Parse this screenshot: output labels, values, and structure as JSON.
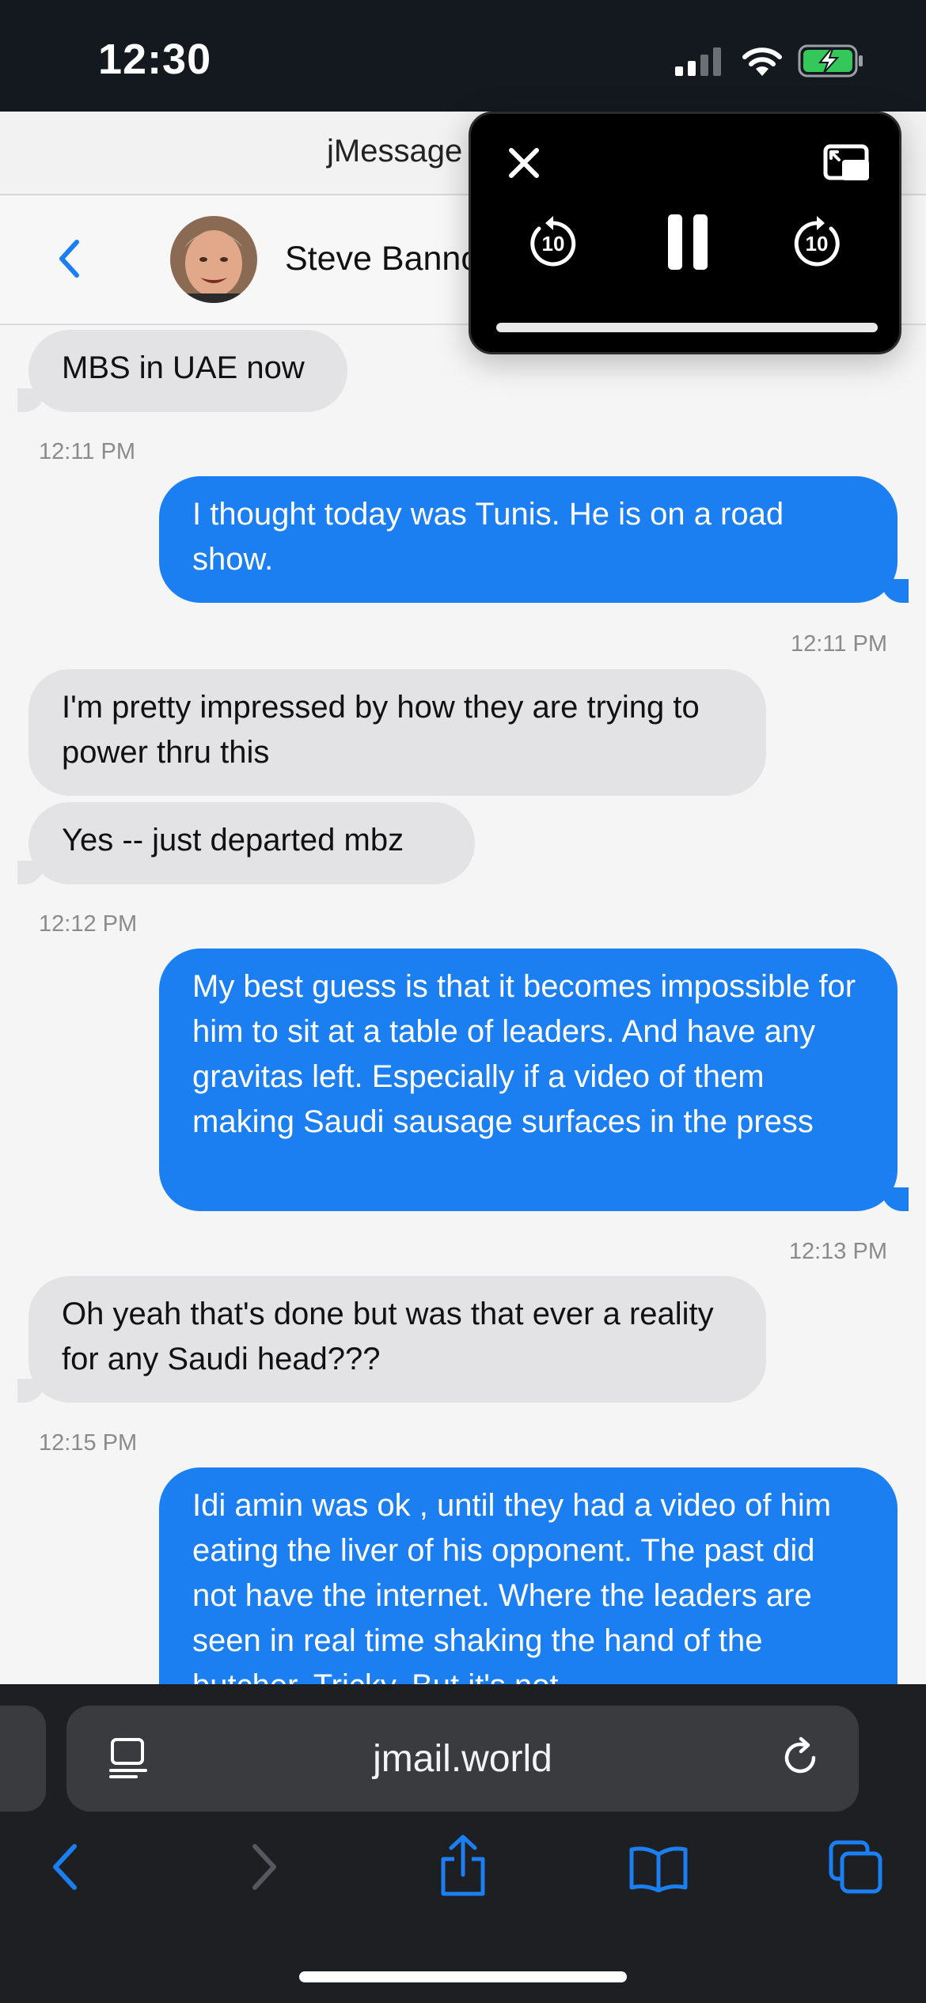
{
  "status_bar": {
    "time": "12:30"
  },
  "page": {
    "title": "jMessage"
  },
  "contact": {
    "name": "Steve Bannon"
  },
  "messages": [
    {
      "direction": "in",
      "text": "MBS in UAE now"
    },
    {
      "timestamp": "12:11 PM"
    },
    {
      "direction": "out",
      "text": "I thought today was Tunis. He is on a road show."
    },
    {
      "timestamp": "12:11 PM"
    },
    {
      "direction": "in",
      "text": "I'm pretty impressed by how they are trying to power thru this"
    },
    {
      "direction": "in",
      "text": "Yes -- just departed mbz"
    },
    {
      "timestamp": "12:12 PM"
    },
    {
      "direction": "out",
      "text": "My best guess is that it becomes impossible for him to sit at a table of leaders. And have any gravitas left. Especially if a video of them making Saudi sausage surfaces in the press"
    },
    {
      "timestamp": "12:13 PM"
    },
    {
      "direction": "in",
      "text": "Oh yeah that's done but was that ever a reality for any Saudi head???"
    },
    {
      "timestamp": "12:15 PM"
    },
    {
      "direction": "out",
      "text": "Idi amin was ok , until they had a video of him eating the liver of his opponent. The past did not have the internet. Where the leaders are seen in real time shaking the hand of the butcher. Tricky. But it's not"
    }
  ],
  "pip": {
    "skip_back_seconds": "10",
    "skip_forward_seconds": "10",
    "progress": 1.0
  },
  "browser": {
    "url": "jmail.world"
  },
  "colors": {
    "outgoing_bubble": "#1b7ef1",
    "incoming_bubble": "#e3e3e6",
    "accent": "#1b7ef1"
  }
}
